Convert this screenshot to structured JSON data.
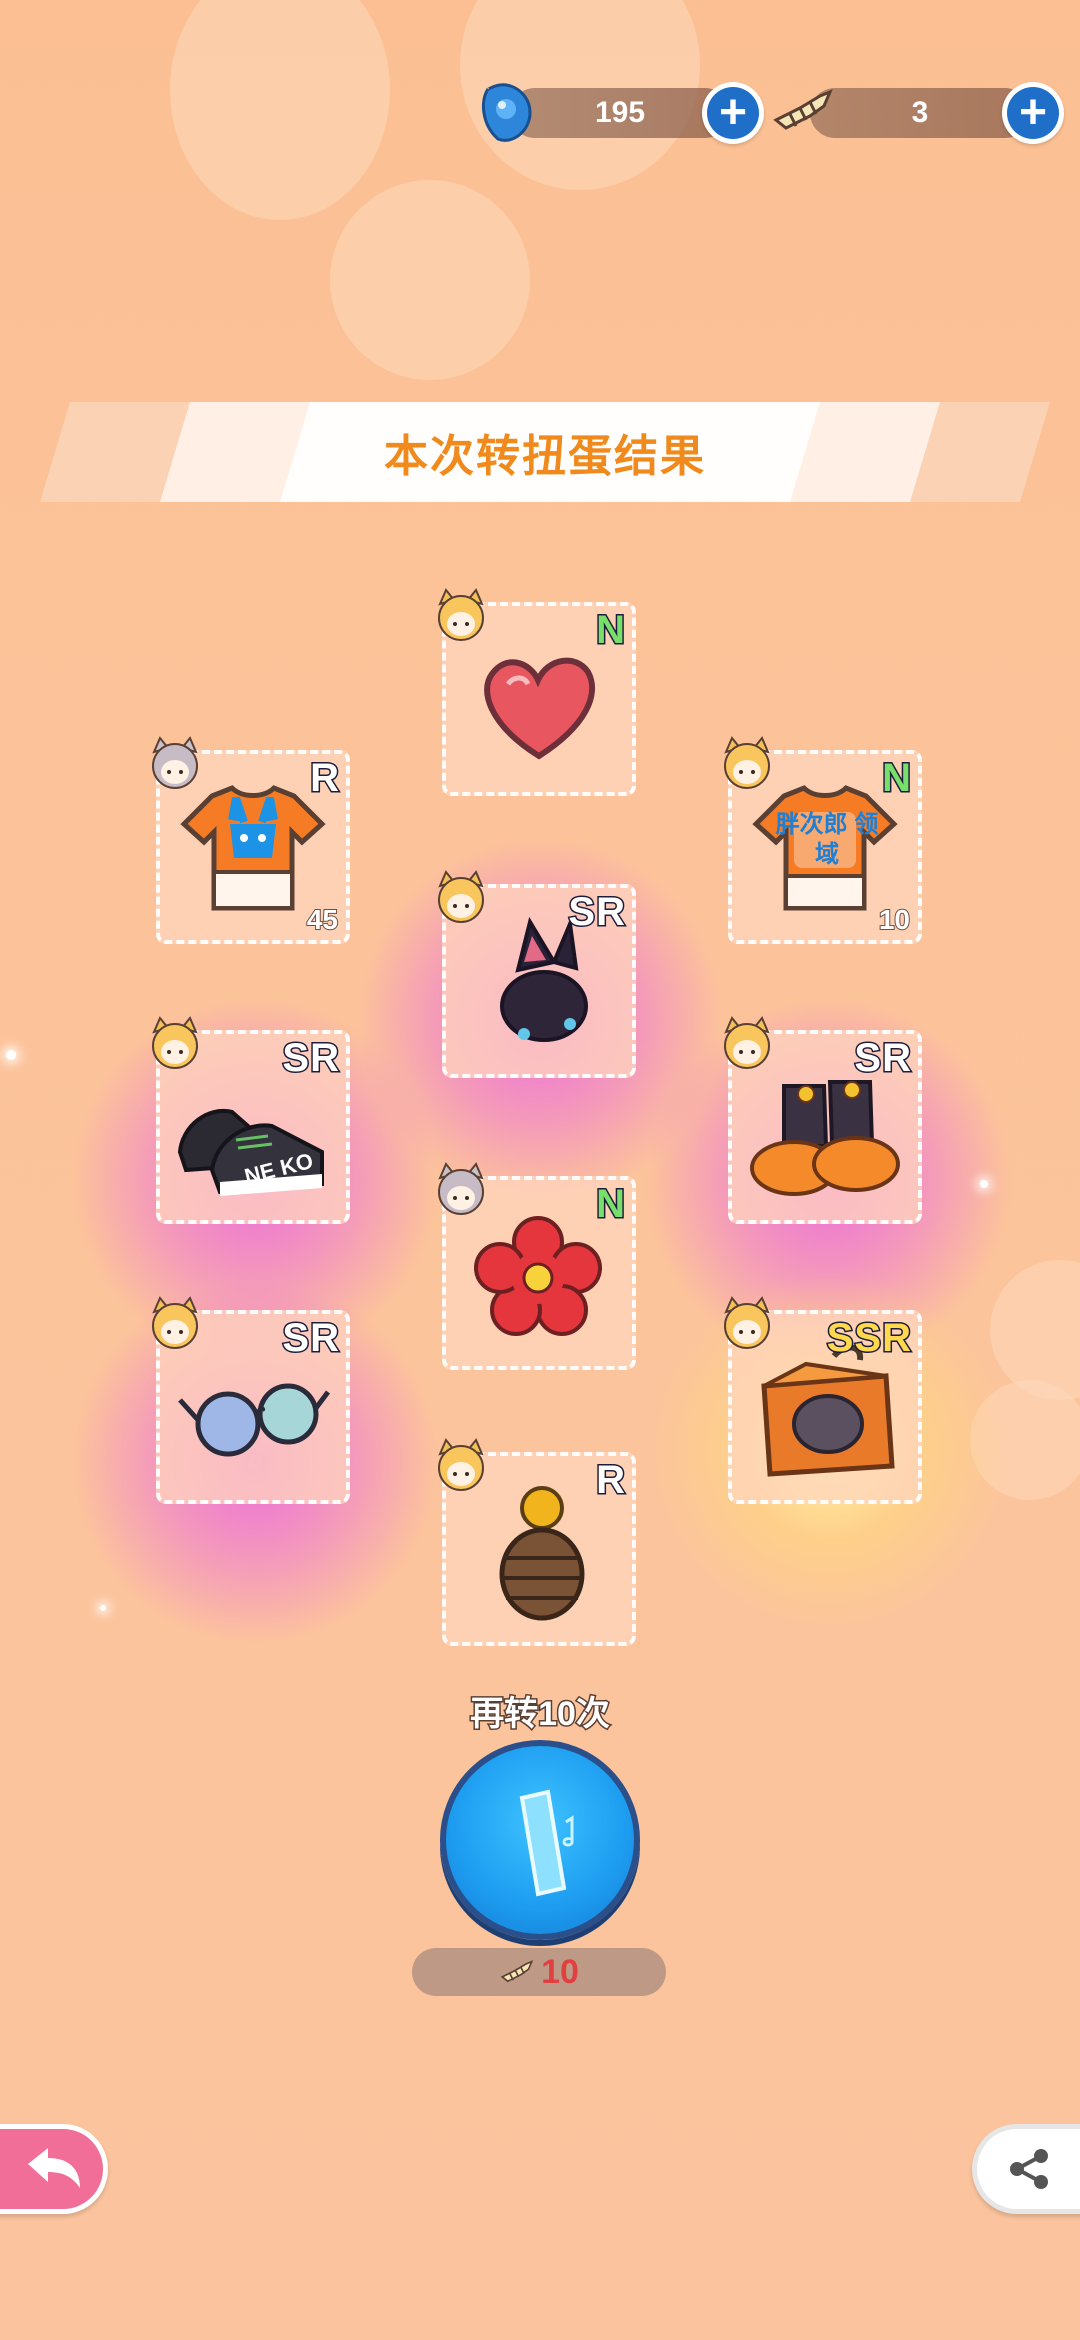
{
  "currency": {
    "gems": "195",
    "tickets": "3",
    "add_symbol": "+",
    "gem_icon": "blue-gem-icon",
    "ticket_icon": "fish-bone-ticket-icon"
  },
  "banner": {
    "title": "本次转扭蛋结果"
  },
  "items": [
    {
      "rarity": "N",
      "count": "",
      "name": "heart"
    },
    {
      "rarity": "R",
      "count": "45",
      "name": "orange-bunny-tshirt"
    },
    {
      "rarity": "N",
      "count": "10",
      "name": "orange-text-tshirt"
    },
    {
      "rarity": "SR",
      "count": "",
      "name": "cat-ear-headband"
    },
    {
      "rarity": "SR",
      "count": "",
      "name": "black-sneakers"
    },
    {
      "rarity": "SR",
      "count": "",
      "name": "pumpkin-boots"
    },
    {
      "rarity": "N",
      "count": "",
      "name": "red-flower"
    },
    {
      "rarity": "SR",
      "count": "",
      "name": "round-glasses"
    },
    {
      "rarity": "SSR",
      "count": "",
      "name": "orange-chest"
    },
    {
      "rarity": "R",
      "count": "",
      "name": "barrel-bead"
    }
  ],
  "tshirt_text": "胖次郎 领域",
  "sneaker_text": "NE KO",
  "spin": {
    "label": "再转10次",
    "cost": "10",
    "cost_icon": "fish-bone-ticket-icon"
  },
  "colors": {
    "background": "#fcc39a",
    "banner_text": "#f08a1c",
    "sr_glow": "#e040e0",
    "ssr_glow": "#ffe066",
    "spin_button": "#1d9cf0",
    "back_button": "#f06e98"
  }
}
